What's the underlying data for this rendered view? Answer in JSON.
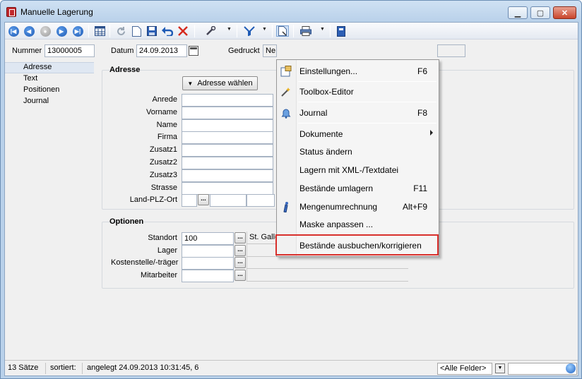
{
  "window": {
    "title": "Manuelle Lagerung"
  },
  "header": {
    "nummer_label": "Nummer",
    "nummer_value": "13000005",
    "datum_label": "Datum",
    "datum_value": "24.09.2013",
    "gedruckt_label": "Gedruckt",
    "gedruckt_value": "Ne"
  },
  "sidebar": {
    "items": [
      {
        "label": "Adresse",
        "active": true
      },
      {
        "label": "Text"
      },
      {
        "label": "Positionen"
      },
      {
        "label": "Journal"
      }
    ]
  },
  "adresse": {
    "title": "Adresse",
    "choose_button": "Adresse wählen",
    "fields": [
      {
        "label": "Anrede",
        "value": ""
      },
      {
        "label": "Vorname",
        "value": ""
      },
      {
        "label": "Name",
        "value": ""
      },
      {
        "label": "Firma",
        "value": ""
      },
      {
        "label": "Zusatz1",
        "value": ""
      },
      {
        "label": "Zusatz2",
        "value": ""
      },
      {
        "label": "Zusatz3",
        "value": ""
      },
      {
        "label": "Strasse",
        "value": ""
      }
    ],
    "land_label": "Land-PLZ-Ort",
    "dots": "..."
  },
  "optionen": {
    "title": "Optionen",
    "rows": [
      {
        "label": "Standort",
        "value": "100",
        "description": "St. Gallen"
      },
      {
        "label": "Lager",
        "value": "",
        "description": ""
      },
      {
        "label": "Kostenstelle/-träger",
        "value": "",
        "description": ""
      },
      {
        "label": "Mitarbeiter",
        "value": "",
        "description": ""
      }
    ]
  },
  "context_menu": {
    "items": [
      {
        "label": "Einstellungen...",
        "shortcut": "F6",
        "icon": "settings-icon"
      },
      {
        "label": "Toolbox-Editor",
        "shortcut": "",
        "icon": "wand-icon"
      },
      {
        "label": "Journal",
        "shortcut": "F8",
        "icon": "bell-icon"
      },
      {
        "label": "Dokumente",
        "shortcut": "",
        "icon": "",
        "submenu": true
      },
      {
        "label": "Status ändern",
        "shortcut": "",
        "icon": ""
      },
      {
        "label": "Lagern mit XML-/Textdatei",
        "shortcut": "",
        "icon": ""
      },
      {
        "label": "Bestände umlagern",
        "shortcut": "F11",
        "icon": ""
      },
      {
        "label": "Mengenumrechnung",
        "shortcut": "Alt+F9",
        "icon": "pen-icon"
      },
      {
        "label": "Maske anpassen ...",
        "shortcut": "",
        "icon": ""
      },
      {
        "label": "Bestände ausbuchen/korrigieren",
        "shortcut": "",
        "icon": ""
      }
    ],
    "highlighted_index": 9,
    "highlight_color": "#d8302c"
  },
  "statusbar": {
    "count": "13 Sätze",
    "sorted": "sortiert:",
    "created": "angelegt 24.09.2013 10:31:45,  6",
    "filter": "<Alle Felder>",
    "search": ""
  }
}
